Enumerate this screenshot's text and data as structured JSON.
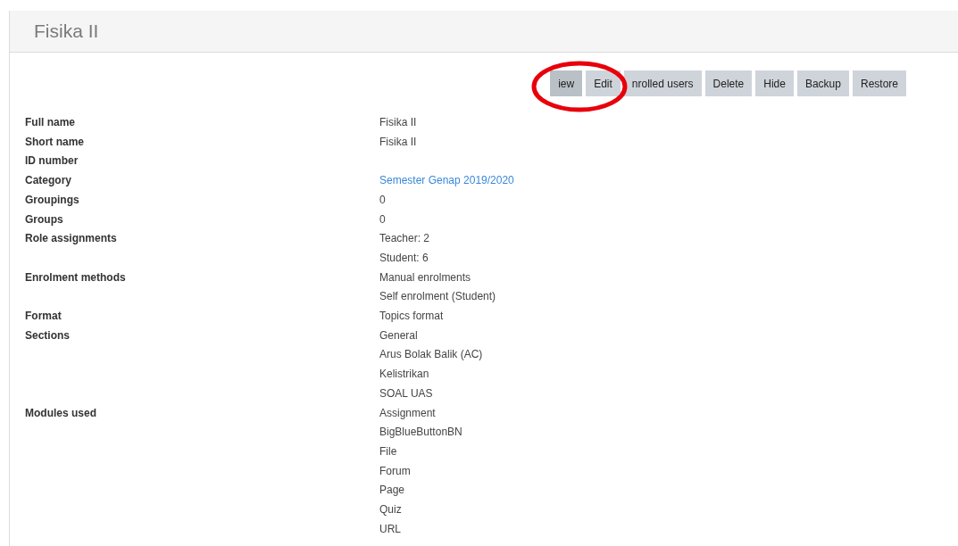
{
  "header": {
    "title": "Fisika II"
  },
  "buttons": [
    {
      "label": "iew",
      "selected": true
    },
    {
      "label": "Edit",
      "selected": false
    },
    {
      "label": "nrolled users",
      "selected": false
    },
    {
      "label": "Delete",
      "selected": false
    },
    {
      "label": "Hide",
      "selected": false
    },
    {
      "label": "Backup",
      "selected": false
    },
    {
      "label": "Restore",
      "selected": false
    }
  ],
  "details": [
    {
      "label": "Full name",
      "values": [
        {
          "text": "Fisika II",
          "kind": "text"
        }
      ]
    },
    {
      "label": "Short name",
      "values": [
        {
          "text": "Fisika II",
          "kind": "text"
        }
      ]
    },
    {
      "label": "ID number"
    },
    {
      "label": "Category",
      "values": [
        {
          "text": "Semester Genap 2019/2020",
          "kind": "link"
        }
      ]
    },
    {
      "label": "Groupings",
      "values": [
        {
          "text": "0",
          "kind": "text"
        }
      ]
    },
    {
      "label": "Groups",
      "values": [
        {
          "text": "0",
          "kind": "text"
        }
      ]
    },
    {
      "label": "Role assignments",
      "values": [
        {
          "text": "Teacher: 2",
          "kind": "text"
        },
        {
          "text": "Student: 6",
          "kind": "text"
        }
      ]
    },
    {
      "label": "Enrolment methods",
      "values": [
        {
          "text": "Manual enrolments",
          "kind": "text"
        },
        {
          "text": "Self enrolment (Student)",
          "kind": "text"
        }
      ]
    },
    {
      "label": "Format",
      "values": [
        {
          "text": "Topics format",
          "kind": "text"
        }
      ]
    },
    {
      "label": "Sections",
      "values": [
        {
          "text": "General",
          "kind": "text"
        },
        {
          "text": "Arus Bolak Balik (AC)",
          "kind": "text"
        },
        {
          "text": "Kelistrikan",
          "kind": "text"
        },
        {
          "text": "SOAL UAS",
          "kind": "text"
        }
      ]
    },
    {
      "label": "Modules used",
      "values": [
        {
          "text": "Assignment",
          "kind": "text"
        },
        {
          "text": "BigBlueButtonBN",
          "kind": "text"
        },
        {
          "text": "File",
          "kind": "text"
        },
        {
          "text": "Forum",
          "kind": "text"
        },
        {
          "text": "Page",
          "kind": "text"
        },
        {
          "text": "Quiz",
          "kind": "text"
        },
        {
          "text": "URL",
          "kind": "text"
        }
      ]
    }
  ]
}
